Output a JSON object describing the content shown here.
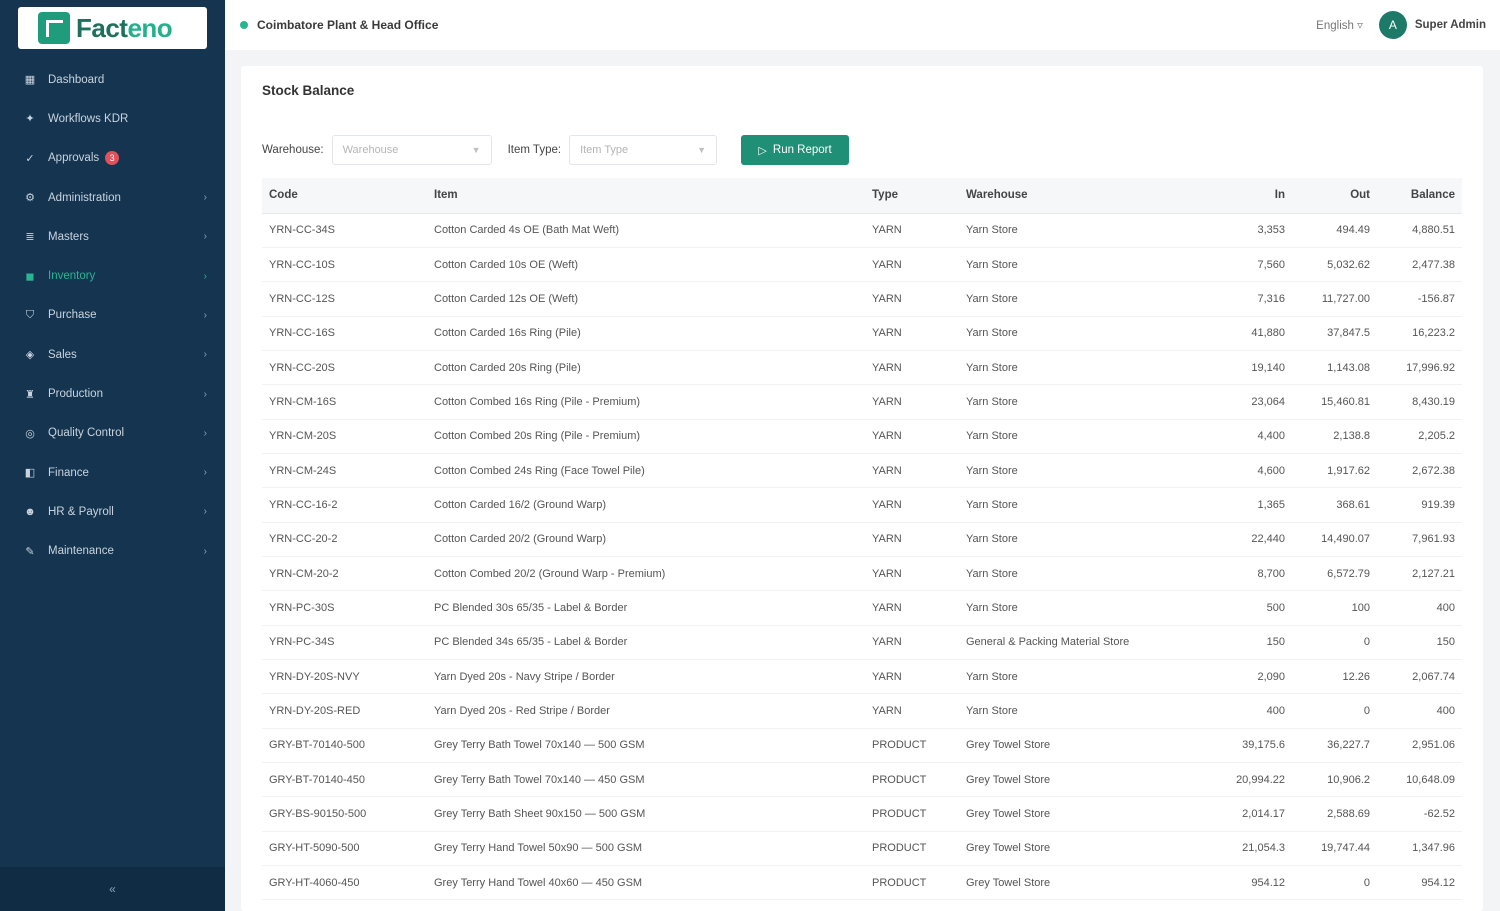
{
  "app": {
    "logo_prefix": "Fact",
    "logo_suffix": "eno"
  },
  "sidebar": {
    "items": [
      {
        "label": "Dashboard",
        "icon": "dashboard-icon",
        "glyph": "▦",
        "chevron": false,
        "active": false
      },
      {
        "label": "Workflows KDR",
        "icon": "workflow-icon",
        "glyph": "✦",
        "chevron": false,
        "active": false
      },
      {
        "label": "Approvals",
        "icon": "approval-icon",
        "glyph": "✓",
        "chevron": false,
        "active": false,
        "badge": "3"
      },
      {
        "label": "Administration",
        "icon": "gear-icon",
        "glyph": "⚙",
        "chevron": true,
        "active": false
      },
      {
        "label": "Masters",
        "icon": "database-icon",
        "glyph": "≣",
        "chevron": true,
        "active": false
      },
      {
        "label": "Inventory",
        "icon": "box-icon",
        "glyph": "◼",
        "chevron": true,
        "active": true
      },
      {
        "label": "Purchase",
        "icon": "cart-icon",
        "glyph": "⛉",
        "chevron": true,
        "active": false
      },
      {
        "label": "Sales",
        "icon": "tag-icon",
        "glyph": "◈",
        "chevron": true,
        "active": false
      },
      {
        "label": "Production",
        "icon": "factory-icon",
        "glyph": "♜",
        "chevron": true,
        "active": false
      },
      {
        "label": "Quality Control",
        "icon": "shield-icon",
        "glyph": "◎",
        "chevron": true,
        "active": false
      },
      {
        "label": "Finance",
        "icon": "finance-icon",
        "glyph": "◧",
        "chevron": true,
        "active": false
      },
      {
        "label": "HR & Payroll",
        "icon": "people-icon",
        "glyph": "☻",
        "chevron": true,
        "active": false
      },
      {
        "label": "Maintenance",
        "icon": "wrench-icon",
        "glyph": "✎",
        "chevron": true,
        "active": false
      }
    ],
    "collapse_glyph": "«"
  },
  "topbar": {
    "site": "Coimbatore Plant & Head Office",
    "language": "English ▿",
    "avatar_initial": "A",
    "user": "Super Admin"
  },
  "page": {
    "title": "Stock Balance",
    "filters": {
      "warehouse_label": "Warehouse:",
      "warehouse_placeholder": "Warehouse",
      "item_type_label": "Item Type:",
      "item_type_placeholder": "Item Type",
      "run_label": "Run Report"
    },
    "table": {
      "headers": [
        "Code",
        "Item",
        "Type",
        "Warehouse",
        "In",
        "Out",
        "Balance"
      ],
      "rows": [
        [
          "YRN-CC-34S",
          "Cotton Carded 4s OE (Bath Mat Weft)",
          "YARN",
          "Yarn Store",
          "3,353",
          "494.49",
          "4,880.51"
        ],
        [
          "YRN-CC-10S",
          "Cotton Carded 10s OE (Weft)",
          "YARN",
          "Yarn Store",
          "7,560",
          "5,032.62",
          "2,477.38"
        ],
        [
          "YRN-CC-12S",
          "Cotton Carded 12s OE (Weft)",
          "YARN",
          "Yarn Store",
          "7,316",
          "11,727.00",
          "-156.87"
        ],
        [
          "YRN-CC-16S",
          "Cotton Carded 16s Ring (Pile)",
          "YARN",
          "Yarn Store",
          "41,880",
          "37,847.5",
          "16,223.2"
        ],
        [
          "YRN-CC-20S",
          "Cotton Carded 20s Ring (Pile)",
          "YARN",
          "Yarn Store",
          "19,140",
          "1,143.08",
          "17,996.92"
        ],
        [
          "YRN-CM-16S",
          "Cotton Combed 16s Ring (Pile - Premium)",
          "YARN",
          "Yarn Store",
          "23,064",
          "15,460.81",
          "8,430.19"
        ],
        [
          "YRN-CM-20S",
          "Cotton Combed 20s Ring (Pile - Premium)",
          "YARN",
          "Yarn Store",
          "4,400",
          "2,138.8",
          "2,205.2"
        ],
        [
          "YRN-CM-24S",
          "Cotton Combed 24s Ring (Face Towel Pile)",
          "YARN",
          "Yarn Store",
          "4,600",
          "1,917.62",
          "2,672.38"
        ],
        [
          "YRN-CC-16-2",
          "Cotton Carded 16/2 (Ground Warp)",
          "YARN",
          "Yarn Store",
          "1,365",
          "368.61",
          "919.39"
        ],
        [
          "YRN-CC-20-2",
          "Cotton Carded 20/2 (Ground Warp)",
          "YARN",
          "Yarn Store",
          "22,440",
          "14,490.07",
          "7,961.93"
        ],
        [
          "YRN-CM-20-2",
          "Cotton Combed 20/2 (Ground Warp - Premium)",
          "YARN",
          "Yarn Store",
          "8,700",
          "6,572.79",
          "2,127.21"
        ],
        [
          "YRN-PC-30S",
          "PC Blended 30s 65/35 - Label & Border",
          "YARN",
          "Yarn Store",
          "500",
          "100",
          "400"
        ],
        [
          "YRN-PC-34S",
          "PC Blended 34s 65/35 - Label & Border",
          "YARN",
          "General & Packing Material Store",
          "150",
          "0",
          "150"
        ],
        [
          "YRN-DY-20S-NVY",
          "Yarn Dyed 20s - Navy Stripe / Border",
          "YARN",
          "Yarn Store",
          "2,090",
          "12.26",
          "2,067.74"
        ],
        [
          "YRN-DY-20S-RED",
          "Yarn Dyed 20s - Red Stripe / Border",
          "YARN",
          "Yarn Store",
          "400",
          "0",
          "400"
        ],
        [
          "GRY-BT-70140-500",
          "Grey Terry Bath Towel 70x140 — 500 GSM",
          "PRODUCT",
          "Grey Towel Store",
          "39,175.6",
          "36,227.7",
          "2,951.06"
        ],
        [
          "GRY-BT-70140-450",
          "Grey Terry Bath Towel 70x140 — 450 GSM",
          "PRODUCT",
          "Grey Towel Store",
          "20,994.22",
          "10,906.2",
          "10,648.09"
        ],
        [
          "GRY-BS-90150-500",
          "Grey Terry Bath Sheet 90x150 — 500 GSM",
          "PRODUCT",
          "Grey Towel Store",
          "2,014.17",
          "2,588.69",
          "-62.52"
        ],
        [
          "GRY-HT-5090-500",
          "Grey Terry Hand Towel 50x90 — 500 GSM",
          "PRODUCT",
          "Grey Towel Store",
          "21,054.3",
          "19,747.44",
          "1,347.96"
        ],
        [
          "GRY-HT-4060-450",
          "Grey Terry Hand Towel 40x60 — 450 GSM",
          "PRODUCT",
          "Grey Towel Store",
          "954.12",
          "0",
          "954.12"
        ]
      ]
    }
  },
  "colors": {
    "sidebar_bg": "#143450",
    "accent": "#1f8f75",
    "active_nav": "#28b592",
    "badge": "#e0525a"
  }
}
